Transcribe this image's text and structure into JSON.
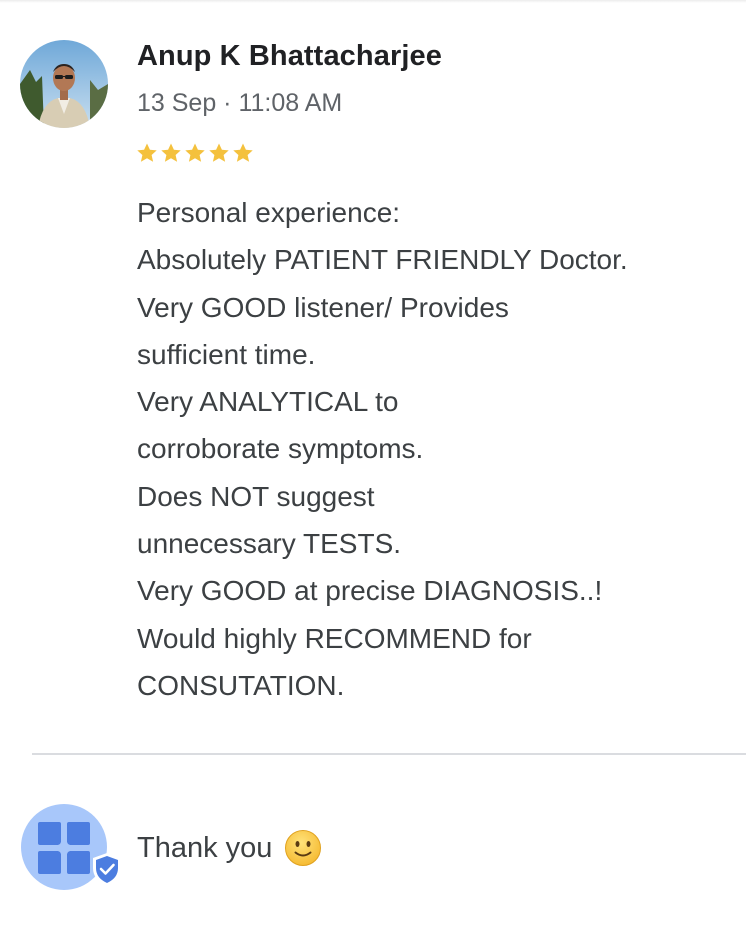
{
  "review": {
    "reviewer_name": "Anup K Bhattacharjee",
    "time": "13 Sep · 11:08 AM",
    "rating": 5,
    "max_rating": 5,
    "lines": [
      "Personal experience:",
      "Absolutely PATIENT FRIENDLY Doctor.",
      "Very GOOD listener/ Provides",
      "sufficient time.",
      "Very ANALYTICAL to",
      "corroborate symptoms.",
      "Does NOT suggest",
      "unnecessary TESTS.",
      "Very GOOD at precise DIAGNOSIS..!",
      "Would highly RECOMMEND for",
      "CONSUTATION."
    ]
  },
  "owner_response": {
    "text": "Thank you",
    "emoji": "slightly-smiling-face-icon"
  },
  "colors": {
    "star": "#f4c13d",
    "avatar_owner_bg": "#a8c7fa",
    "avatar_owner_tile": "#4c7de0",
    "verified_badge": "#4c7de0"
  }
}
